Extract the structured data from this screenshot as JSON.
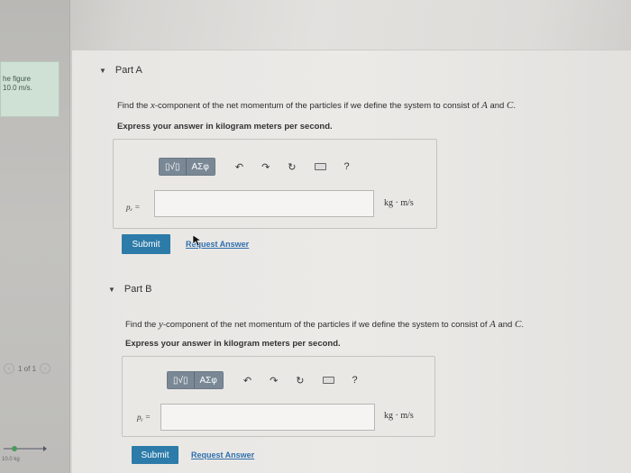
{
  "sidebar": {
    "figure_text_line1": "he figure",
    "figure_text_line2": "10.0 m/s.",
    "pager_prev": "‹",
    "pager_text": "1 of 1",
    "pager_next": "›",
    "diagram_label": "10.0 kg"
  },
  "part_a": {
    "title": "Part A",
    "question_pre": "Find the ",
    "question_var": "x",
    "question_mid": "-component of the net momentum of the particles if we define the system to consist of ",
    "question_a": "A",
    "question_and": " and ",
    "question_c": "C",
    "question_end": ".",
    "instruction": "Express your answer in kilogram meters per second.",
    "toolbar": {
      "template_btn": "▯√▯",
      "symbols_btn": "ΑΣφ",
      "undo": "↶",
      "redo": "↷",
      "reset": "↻",
      "help": "?"
    },
    "var_label": "pₓ =",
    "input_value": "",
    "unit": "kg · m/s",
    "submit_label": "Submit",
    "request_label": "Request Answer"
  },
  "part_b": {
    "title": "Part B",
    "question_pre": "Find the ",
    "question_var": "y",
    "question_mid": "-component of the net momentum of the particles if we define the system to consist of ",
    "question_a": "A",
    "question_and": " and ",
    "question_c": "C",
    "question_end": ".",
    "instruction": "Express your answer in kilogram meters per second.",
    "toolbar": {
      "template_btn": "▯√▯",
      "symbols_btn": "ΑΣφ",
      "undo": "↶",
      "redo": "↷",
      "reset": "↻",
      "help": "?"
    },
    "var_label": "pᵧ =",
    "input_value": "",
    "unit": "kg · m/s",
    "submit_label": "Submit",
    "request_label": "Request Answer"
  },
  "colors": {
    "submit": "#2c7ba8",
    "toolbar": "#7a8896",
    "link": "#2f6fae",
    "figure_card": "#cfe0d4"
  }
}
